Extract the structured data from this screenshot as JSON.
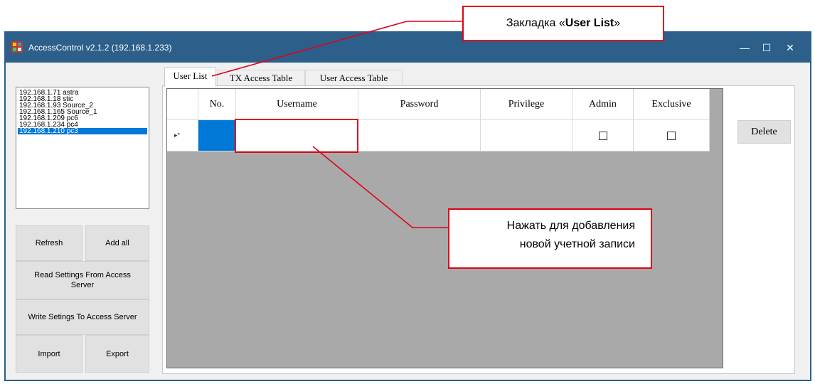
{
  "window": {
    "title": "AccessControl v2.1.2 (192.168.1.233)",
    "controls": {
      "minimize": "—",
      "maximize": "☐",
      "close": "✕"
    }
  },
  "server_list": [
    "192.168.1.71 astra",
    "192.168.1.18 stic",
    "192.168.1.93 Source_2",
    "192.168.1.165 Source_1",
    "192.168.1.209 pc6",
    "192.168.1.234 pc4",
    "192.168.1.210 pc3"
  ],
  "selected_server": "192.168.1.210 pc3",
  "buttons": {
    "refresh": "Refresh",
    "add_all": "Add all",
    "read_settings": "Read Settings From Access Server",
    "write_settings": "Write Setings To Access Server",
    "import": "Import",
    "export": "Export",
    "delete": "Delete"
  },
  "tabs": [
    "User List",
    "TX Access Table",
    "User Access Table"
  ],
  "active_tab": "User List",
  "table": {
    "columns": [
      "No.",
      "Username",
      "Password",
      "Privilege",
      "Admin",
      "Exclusive"
    ],
    "new_row_marker": "▸*"
  },
  "annotations": {
    "tab_callout_prefix": "Закладка «",
    "tab_callout_bold": "User List",
    "tab_callout_suffix": "»",
    "add_callout_line1": "Нажать для добавления",
    "add_callout_line2": "новой учетной записи",
    "color": "#e0001a"
  },
  "colors": {
    "titlebar": "#2c5f8a",
    "selection": "#0078d7",
    "grid_bg": "#a9a9a9"
  }
}
